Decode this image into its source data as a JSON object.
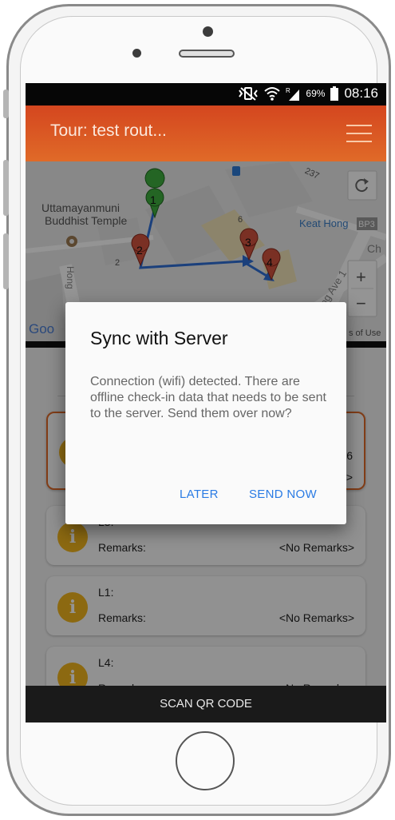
{
  "status_bar": {
    "battery_percent": "69%",
    "time": "08:16",
    "icons": [
      "vibrate-icon",
      "wifi-icon",
      "signal-icon",
      "battery-icon"
    ]
  },
  "app_bar": {
    "title": "Tour: test rout...",
    "menu_icon": "hamburger-menu-icon"
  },
  "map": {
    "place_labels": [
      "Uttamayanmuni",
      "Buddhist Temple",
      "Keat Hong",
      "BP3",
      "237",
      "6",
      "2",
      "Hong",
      "ang Ave 1",
      "Ch"
    ],
    "attribution_partial": "Goo",
    "terms_partial": "s of Use",
    "markers": [
      "1",
      "2",
      "3",
      "4"
    ],
    "zoom_in": "+",
    "zoom_out": "−",
    "refresh_icon": "refresh-icon",
    "colors": {
      "start_marker": "#3fae3f",
      "stop_marker": "#d2533e",
      "route": "#2f6fd6"
    }
  },
  "checkpoints": [
    {
      "title": "",
      "remarks_label": "",
      "remarks_value": "6",
      "remarks_value2": "s>"
    },
    {
      "title": "L3:",
      "remarks_label": "Remarks:",
      "remarks_value": "<No Remarks>"
    },
    {
      "title": "L1:",
      "remarks_label": "Remarks:",
      "remarks_value": "<No Remarks>"
    },
    {
      "title": "L4:",
      "remarks_label": "Remarks:",
      "remarks_value": "<No Remarks>"
    }
  ],
  "scan_button": {
    "label": "SCAN QR CODE"
  },
  "dialog": {
    "title": "Sync with Server",
    "message": "Connection (wifi) detected. There are offline check-in data that needs to be sent to the server. Send them over now?",
    "later_label": "LATER",
    "send_now_label": "SEND NOW"
  },
  "colors": {
    "accent": "#e06a28",
    "info_icon": "#f2b51e",
    "dialog_button": "#2a7be4"
  }
}
